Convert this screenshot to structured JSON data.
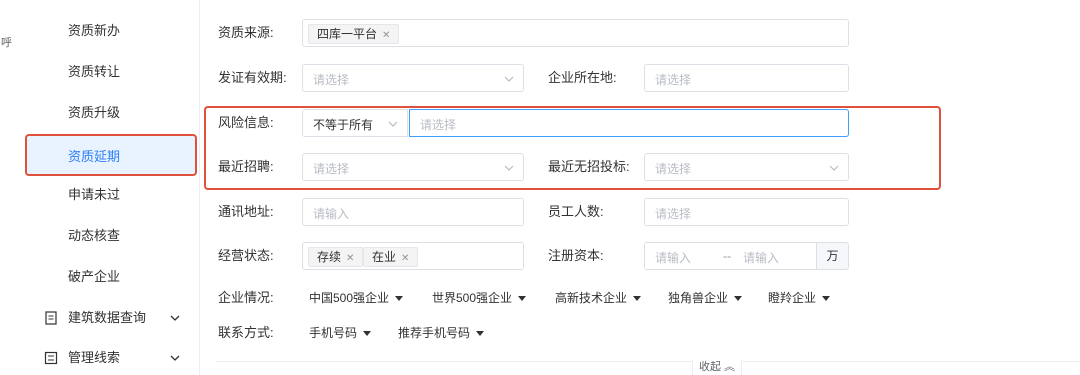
{
  "left_strip_char": "呼",
  "sidebar": {
    "items": [
      "资质新办",
      "资质转让",
      "资质升级"
    ],
    "active_item": "资质延期",
    "items_after": [
      "申请未过",
      "动态核查",
      "破产企业"
    ],
    "groups": [
      {
        "label": "建筑数据查询",
        "icon": "document-icon"
      },
      {
        "label": "管理线索",
        "icon": "list-icon"
      }
    ]
  },
  "form": {
    "source": {
      "label": "资质来源:",
      "tags": [
        "四库一平台"
      ]
    },
    "validity": {
      "label": "发证有效期:",
      "placeholder": "请选择"
    },
    "location": {
      "label": "企业所在地:",
      "placeholder": "请选择"
    },
    "risk": {
      "label": "风险信息:",
      "operator": "不等于所有",
      "placeholder": "请选择"
    },
    "recruit": {
      "label": "最近招聘:",
      "placeholder": "请选择"
    },
    "no_bid": {
      "label": "最近无招投标:",
      "placeholder": "请选择"
    },
    "address": {
      "label": "通讯地址:",
      "placeholder": "请输入"
    },
    "staff": {
      "label": "员工人数:",
      "placeholder": "请选择"
    },
    "status": {
      "label": "经营状态:",
      "tags": [
        "存续",
        "在业"
      ]
    },
    "capital": {
      "label": "注册资本:",
      "min_placeholder": "请输入",
      "separator": "--",
      "max_placeholder": "请输入",
      "unit": "万"
    },
    "situation": {
      "label": "企业情况:",
      "options": [
        "中国500强企业",
        "世界500强企业",
        "高新技术企业",
        "独角兽企业",
        "瞪羚企业"
      ]
    },
    "contact": {
      "label": "联系方式:",
      "options": [
        "手机号码",
        "推荐手机号码"
      ]
    }
  },
  "collapse": {
    "label": "收起",
    "icon": "double-chevron-up-icon"
  },
  "colors": {
    "accent": "#2d7df6",
    "highlight": "#e0513c",
    "active_bg": "#e8f3ff"
  }
}
